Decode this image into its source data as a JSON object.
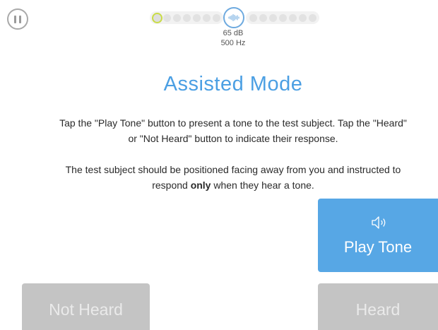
{
  "header": {
    "pause_icon": "pause-icon",
    "progress": {
      "left_dots": 7,
      "right_dots": 7,
      "completed_dots": 1,
      "center_icon": "sound-wave-icon"
    },
    "level": "65 dB",
    "frequency": "500 Hz"
  },
  "main": {
    "title": "Assisted Mode",
    "instruction_1": "Tap the \"Play Tone\" button to present a tone to the test subject. Tap the \"Heard\" or \"Not Heard\" button to indicate their response.",
    "instruction_2_before": "The test subject should be positioned facing away from you and instructed to respond ",
    "instruction_2_bold": "only",
    "instruction_2_after": " when they hear a tone."
  },
  "buttons": {
    "play_tone": {
      "label": "Play Tone",
      "icon": "speaker-icon",
      "color": "#57a7e5"
    },
    "not_heard": {
      "label": "Not Heard",
      "color": "#c4c4c4"
    },
    "heard": {
      "label": "Heard",
      "color": "#c4c4c4"
    }
  },
  "colors": {
    "accent": "#4b9fe3",
    "progress_done": "#c9dc46"
  }
}
